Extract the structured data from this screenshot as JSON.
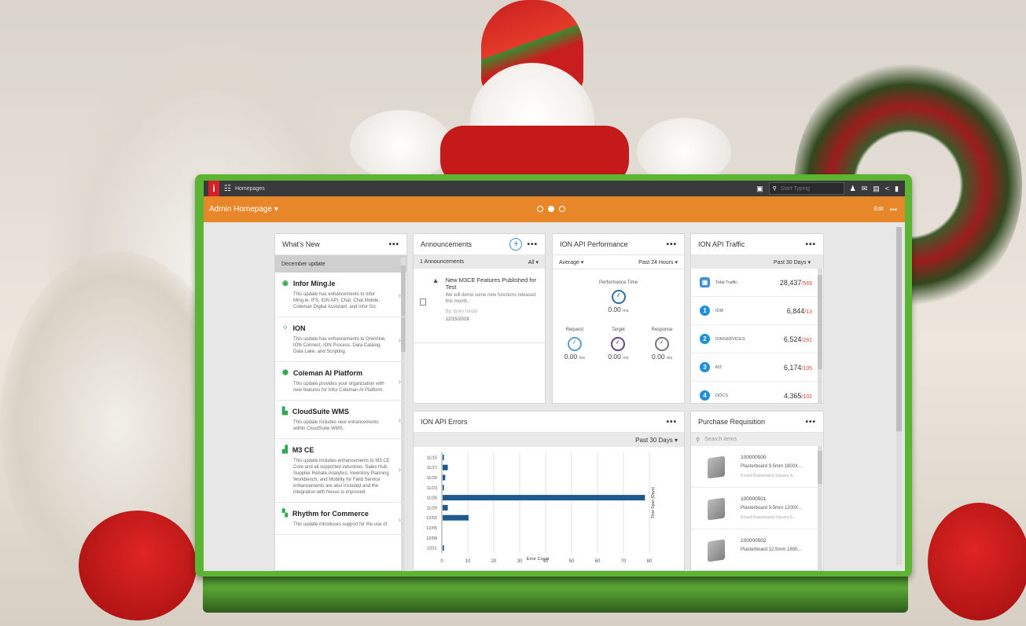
{
  "topbar": {
    "logo": "i",
    "app": "Homepages",
    "search_placeholder": "Start Typing"
  },
  "page": {
    "title": "Admin Homepage",
    "edit": "Edit",
    "more": "•••"
  },
  "whats_new": {
    "title": "What's New",
    "more": "•••",
    "subheader": "December update",
    "items": [
      {
        "title": "Infor Ming.le",
        "desc": "This update has enhancements to Infor Ming.le, IFS, ION API, Chat, Chat Mobile, Coleman Digital Assistant, and Infor Go."
      },
      {
        "title": "ION",
        "desc": "This update has enhancements to OneView, ION Connect, ION Process, Data Catalog, Data Lake, and Scripting."
      },
      {
        "title": "Coleman AI Platform",
        "desc": "This update provides your organization with new features for Infor Coleman AI Platform."
      },
      {
        "title": "CloudSuite WMS",
        "desc": "This update includes new enhancements within CloudSuite WMS."
      },
      {
        "title": "M3 CE",
        "desc": "This update includes enhancements to M3 CE Core and all supported industries. Sales Hub, Supplier Rebate,Analytics, Inventory Planning Workbench, and Mobility for Field Service enhancements are also included and the integration with Nexus is improved."
      },
      {
        "title": "Rhythm for Commerce",
        "desc": "This update introduces support for the use of"
      }
    ]
  },
  "announcements": {
    "title": "Announcements",
    "more": "•••",
    "count_label": "1 Announcements",
    "filter": "All ▾",
    "item": {
      "title": "New M3CE Features Published for Test",
      "desc": "We will demo some new functions released this month.",
      "by": "By: bjorn torold",
      "date": "12/15/2019"
    }
  },
  "performance": {
    "title": "ION API Performance",
    "more": "•••",
    "metric": "Average ▾",
    "range": "Past 24 Hours ▾",
    "main_label": "Performance Time",
    "main_value": "0.00",
    "unit": "ms",
    "cols": [
      {
        "label": "Request",
        "value": "0.00",
        "color": "#5b9fd6"
      },
      {
        "label": "Target",
        "value": "0.00",
        "color": "#6b3f8a"
      },
      {
        "label": "Response",
        "value": "0.00",
        "color": "#777777"
      }
    ],
    "main_color": "#2d6ea6"
  },
  "traffic": {
    "title": "ION API Traffic",
    "more": "•••",
    "range": "Past 30 Days ▾",
    "rows": [
      {
        "badge": "▣",
        "label": "Total Traffic",
        "value": "28,437",
        "err": "/569"
      },
      {
        "badge": "1",
        "label": "IDM",
        "value": "6,844",
        "err": "/13"
      },
      {
        "badge": "2",
        "label": "IONSERVICES",
        "value": "6,524",
        "err": "/281"
      },
      {
        "badge": "3",
        "label": "M3",
        "value": "6,174",
        "err": "/105"
      },
      {
        "badge": "4",
        "label": "DOCS",
        "value": "4,365",
        "err": "/102"
      }
    ]
  },
  "errors": {
    "title": "ION API Errors",
    "more": "•••",
    "range": "Past 30 Days ▾"
  },
  "chart_data": {
    "type": "bar",
    "orientation": "horizontal",
    "categories": [
      "11/15",
      "11/17",
      "11/20",
      "11/23",
      "11/26",
      "11/29",
      "12/02",
      "12/05",
      "12/08",
      "12/11"
    ],
    "values": [
      0.5,
      2,
      1,
      0.5,
      78,
      2,
      10,
      0,
      0,
      0.5
    ],
    "xlabel": "Error Count",
    "ylabel": "Time Span (Days)",
    "xlim": [
      0,
      80
    ],
    "xticks": [
      0,
      10,
      20,
      30,
      40,
      50,
      60,
      70,
      80
    ],
    "bar_color": "#1f5a8c",
    "grid": true
  },
  "purchase": {
    "title": "Purchase Requisition",
    "more": "•••",
    "search_placeholder": "Search items",
    "items": [
      {
        "id": "100000500",
        "name": "Plasterboard 9.5mm 1800X...",
        "sub": "Knauf Baseboard Square E..."
      },
      {
        "id": "100000501",
        "name": "Plasterboard 9.5mm 1200X...",
        "sub": "Knauf Baseboard Square E..."
      },
      {
        "id": "100000502",
        "name": "Plasterboard 12.5mm 1800...",
        "sub": ""
      }
    ]
  }
}
